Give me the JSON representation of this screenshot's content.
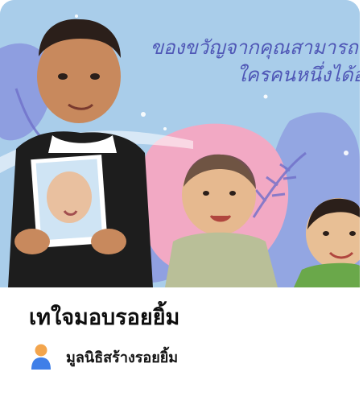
{
  "campaign": {
    "image_caption_line1": "ของขวัญจากคุณสามารถเ",
    "image_caption_line2": "ใครคนหนึ่งได้อ",
    "title": "เทใจมอบรอยยิ้ม",
    "organizer": "มูลนิธิสร้างรอยยิ้ม",
    "organizer_icon": "person-icon"
  },
  "colors": {
    "sky": "#a9cdea",
    "pink": "#f2a9c4",
    "lavender": "#8a95de",
    "caption": "#4f57b6",
    "title_text": "#0d0d0d",
    "icon_orange": "#f3a54d",
    "icon_blue": "#3f7fe8"
  }
}
